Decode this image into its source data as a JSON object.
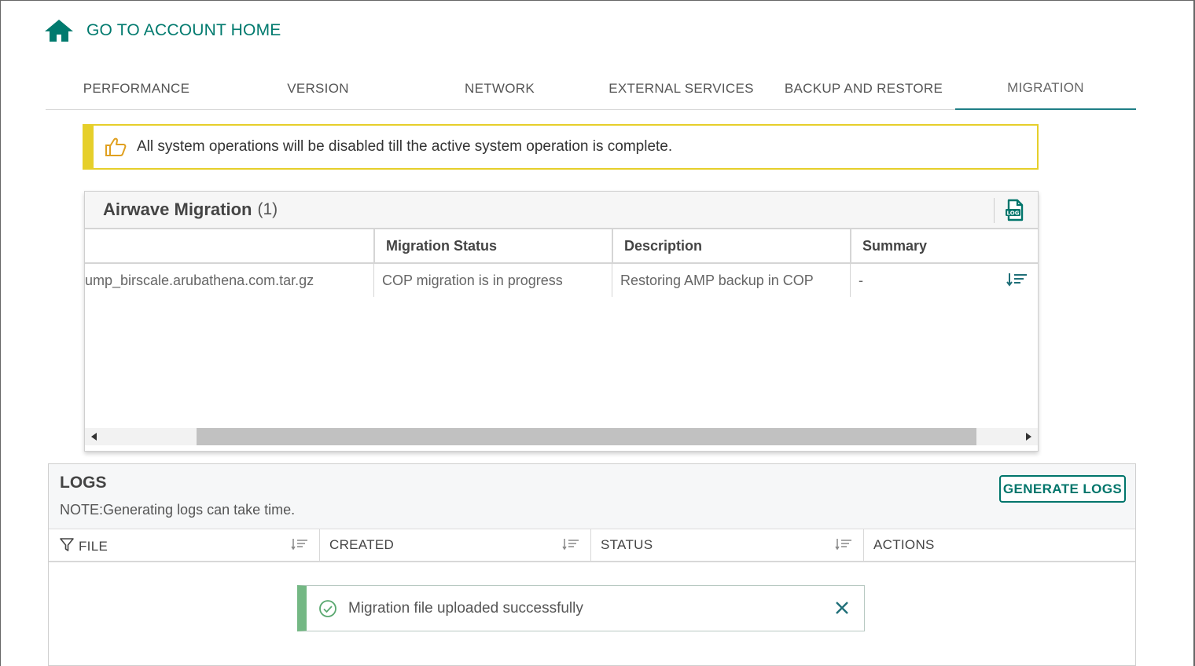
{
  "header": {
    "home_link_label": "GO TO ACCOUNT HOME",
    "icon": "home-icon",
    "accent_color": "#007a6e"
  },
  "tabs": [
    {
      "label": "PERFORMANCE",
      "active": false
    },
    {
      "label": "VERSION",
      "active": false
    },
    {
      "label": "NETWORK",
      "active": false
    },
    {
      "label": "EXTERNAL SERVICES",
      "active": false
    },
    {
      "label": "BACKUP AND RESTORE",
      "active": false
    },
    {
      "label": "MIGRATION",
      "active": true
    }
  ],
  "banner": {
    "icon": "thumbs-up-icon",
    "text": "All system operations will be disabled till the active system operation is complete.",
    "color": "#e6cf2a"
  },
  "migration": {
    "title": "Airwave Migration",
    "count": "(1)",
    "log_icon": "log-file-icon",
    "columns": [
      "",
      "Migration Status",
      "Description",
      "Summary"
    ],
    "rows": [
      {
        "file": "ump_birscale.arubathena.com.tar.gz",
        "status": "COP migration is in progress",
        "description": "Restoring AMP backup in COP",
        "summary": "-"
      }
    ]
  },
  "logs": {
    "title": "LOGS",
    "note": "NOTE:Generating logs can take time.",
    "generate_button": "GENERATE LOGS",
    "columns": {
      "file": "FILE",
      "created": "CREATED",
      "status": "STATUS",
      "actions": "ACTIONS"
    }
  },
  "toast": {
    "message": "Migration file uploaded successfully",
    "icon": "check-circle-icon",
    "close_icon": "close-icon",
    "color": "#74b884"
  }
}
